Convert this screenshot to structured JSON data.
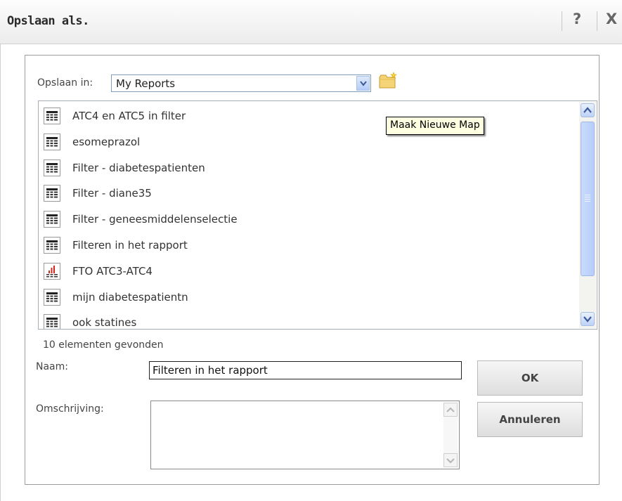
{
  "dialog": {
    "title": "Opslaan als.",
    "help_label": "?",
    "close_label": "X"
  },
  "save_in": {
    "label": "Opslaan in:",
    "selected": "My Reports"
  },
  "tooltip": "Maak Nieuwe Map",
  "files": [
    {
      "name": "ATC4 en ATC5 in filter",
      "icon": "table-icon"
    },
    {
      "name": "esomeprazol",
      "icon": "table-icon"
    },
    {
      "name": "Filter - diabetespatienten",
      "icon": "table-icon"
    },
    {
      "name": "Filter - diane35",
      "icon": "table-icon"
    },
    {
      "name": "Filter - geneesmiddelenselectie",
      "icon": "table-icon"
    },
    {
      "name": "Filteren in het rapport",
      "icon": "table-icon"
    },
    {
      "name": "FTO ATC3-ATC4",
      "icon": "chart-icon"
    },
    {
      "name": "mijn diabetespatientn",
      "icon": "table-icon"
    },
    {
      "name": "ook statines",
      "icon": "table-icon"
    }
  ],
  "count_text": "10 elementen gevonden",
  "name_field": {
    "label": "Naam:",
    "value": "Filteren in het rapport"
  },
  "description_field": {
    "label": "Omschrijving:",
    "value": ""
  },
  "buttons": {
    "ok": "OK",
    "cancel": "Annuleren"
  },
  "colors": {
    "accent_blue": "#b7cefb",
    "chart_red": "#d9261c"
  }
}
